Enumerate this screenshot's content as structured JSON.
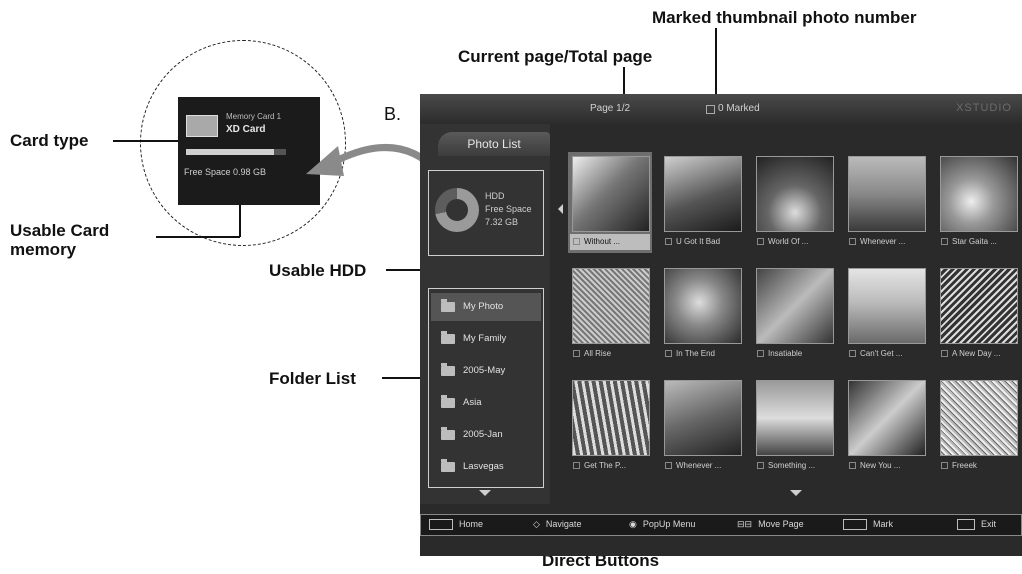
{
  "callouts": {
    "card_type": "Card type",
    "usable_card_memory_1": "Usable Card",
    "usable_card_memory_2": "memory",
    "usable_hdd": "Usable HDD",
    "folder_list": "Folder List",
    "current_page": "Current page/Total page",
    "marked_thumbnail": "Marked thumbnail photo number",
    "direct_buttons": "Direct Buttons",
    "b": "B."
  },
  "inset": {
    "card_label": "Memory Card 1",
    "card_type": "XD Card",
    "free_space": "Free Space 0.98 GB"
  },
  "screen": {
    "page": "Page  1/2",
    "marked": "0 Marked",
    "brand": "XSTUDIO",
    "tab": "Photo List",
    "hdd": {
      "label": "HDD",
      "free": "Free Space",
      "size": "7.32 GB",
      "used_fraction": 0.72
    },
    "folders": [
      "My Photo",
      "My Family",
      "2005-May",
      "Asia",
      "2005-Jan",
      "Lasvegas"
    ],
    "thumbnails": [
      "Without ...",
      "U Got It Bad",
      "World Of ...",
      "Whenever ...",
      "Star Gaita ...",
      "All Rise",
      "In The End",
      "Insatiable",
      "Can't Get ...",
      "A New Day ...",
      "Get The P...",
      "Whenever ...",
      "Something ...",
      "New You ...",
      "Freeek"
    ],
    "buttons": [
      "Home",
      "Navigate",
      "PopUp Menu",
      "Move Page",
      "Mark",
      "Exit"
    ]
  }
}
